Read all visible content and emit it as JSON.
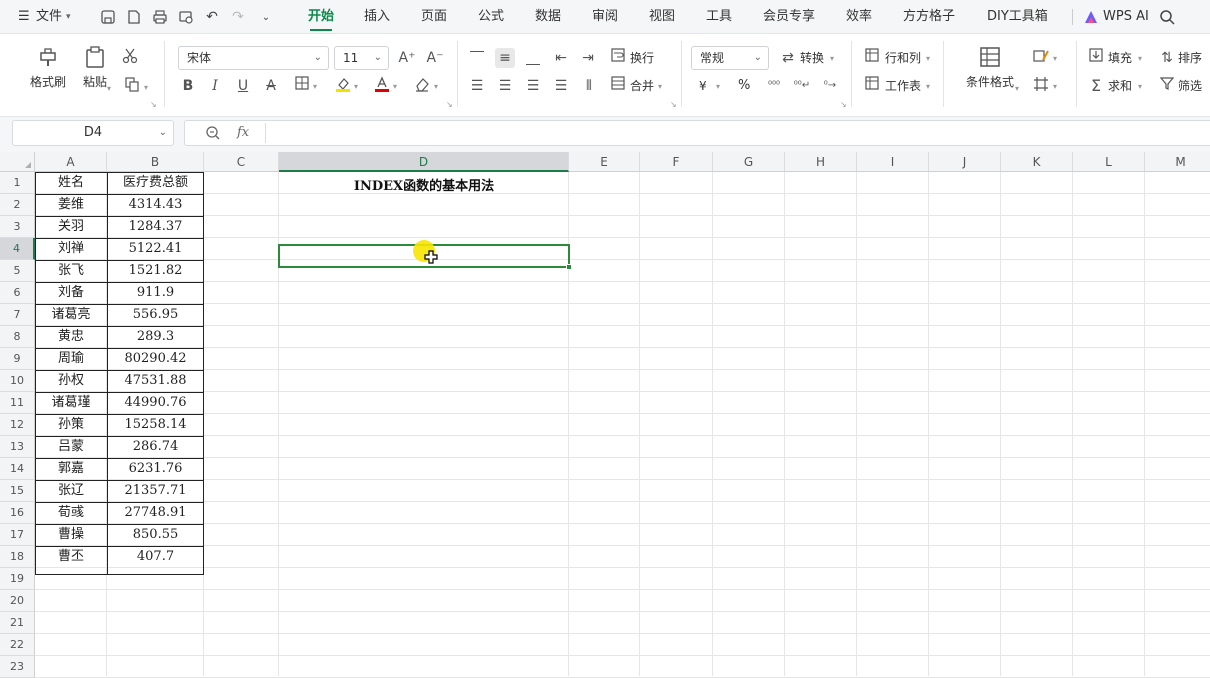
{
  "menu": {
    "hamburger": "☰",
    "file": "文件",
    "tabs": [
      "开始",
      "插入",
      "页面",
      "公式",
      "数据",
      "审阅",
      "视图",
      "工具",
      "会员专享",
      "效率",
      "方方格子",
      "DIY工具箱"
    ],
    "active_tab": "开始",
    "wps_ai": "WPS AI"
  },
  "ribbon": {
    "format_painter": "格式刷",
    "paste": "粘贴",
    "font_name": "宋体",
    "font_size": "11",
    "wrap": "换行",
    "merge": "合并",
    "number_format": "常规",
    "convert": "转换",
    "rows_cols": "行和列",
    "worksheet": "工作表",
    "cond_format": "条件格式",
    "fill": "填充",
    "sort": "排序",
    "sum": "求和",
    "filter": "筛选",
    "bold": "B",
    "italic": "I",
    "underline": "U",
    "strike": "A",
    "currency": "¥",
    "percent": "%"
  },
  "formula_bar": {
    "name_box": "D4",
    "fx": "fx",
    "formula": ""
  },
  "grid": {
    "columns": [
      "A",
      "B",
      "C",
      "D",
      "E",
      "F",
      "G",
      "H",
      "I",
      "J",
      "K",
      "L",
      "M"
    ],
    "selected_column": "D",
    "rows": [
      "1",
      "2",
      "3",
      "4",
      "5",
      "6",
      "7",
      "8",
      "9",
      "10",
      "11",
      "12",
      "13",
      "14",
      "15",
      "16",
      "17",
      "18",
      "19",
      "20",
      "21",
      "22",
      "23"
    ],
    "selected_row": "4",
    "header": {
      "name": "姓名",
      "amount": "医疗费总额"
    },
    "data": [
      {
        "name": "姜维",
        "amount": "4314.43"
      },
      {
        "name": "关羽",
        "amount": "1284.37"
      },
      {
        "name": "刘禅",
        "amount": "5122.41"
      },
      {
        "name": "张飞",
        "amount": "1521.82"
      },
      {
        "name": "刘备",
        "amount": "911.9"
      },
      {
        "name": "诸葛亮",
        "amount": "556.95"
      },
      {
        "name": "黄忠",
        "amount": "289.3"
      },
      {
        "name": "周瑜",
        "amount": "80290.42"
      },
      {
        "name": "孙权",
        "amount": "47531.88"
      },
      {
        "name": "诸葛瑾",
        "amount": "44990.76"
      },
      {
        "name": "孙策",
        "amount": "15258.14"
      },
      {
        "name": "吕蒙",
        "amount": "286.74"
      },
      {
        "name": "郭嘉",
        "amount": "6231.76"
      },
      {
        "name": "张辽",
        "amount": "21357.71"
      },
      {
        "name": "荀彧",
        "amount": "27748.91"
      },
      {
        "name": "曹操",
        "amount": "850.55"
      },
      {
        "name": "曹丕",
        "amount": "407.7"
      }
    ],
    "title": "INDEX函数的基本用法"
  }
}
